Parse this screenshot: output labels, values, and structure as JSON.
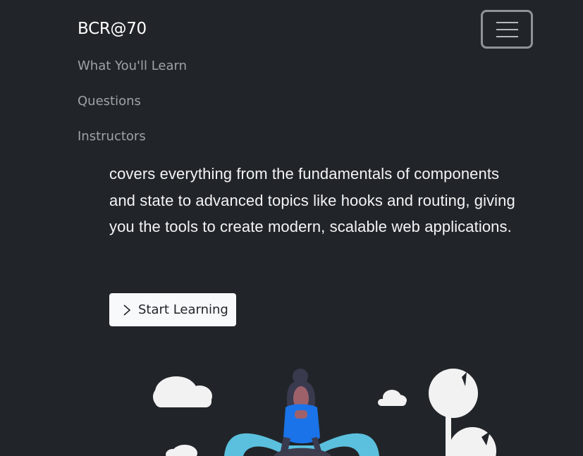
{
  "navbar": {
    "brand": "BCR@70",
    "toggler_icon": "hamburger-menu-icon",
    "links": [
      "What You'll Learn",
      "Questions",
      "Instructors"
    ]
  },
  "hero": {
    "text": "covers everything from the fundamentals of components and state to advanced topics like hooks and routing, giving you the tools to create modern, scalable web applications.",
    "cta_label": "Start Learning",
    "cta_icon": "chevron-right-icon"
  },
  "colors": {
    "background": "#212529",
    "button_bg": "#f8f9fa",
    "illustration_accent": "#5bc0de",
    "illustration_shirt": "#1a73e8"
  }
}
